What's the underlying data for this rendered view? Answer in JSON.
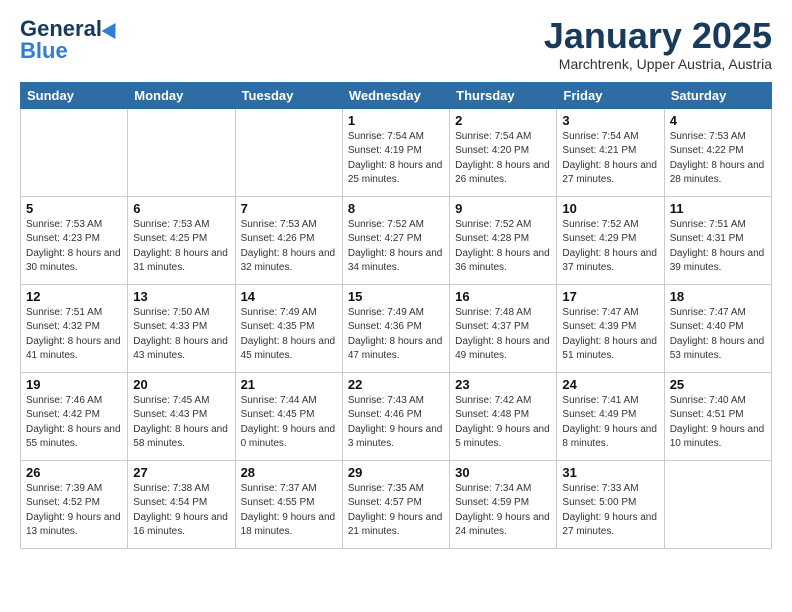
{
  "header": {
    "logo_general": "General",
    "logo_blue": "Blue",
    "month_title": "January 2025",
    "subtitle": "Marchtrenk, Upper Austria, Austria"
  },
  "days_of_week": [
    "Sunday",
    "Monday",
    "Tuesday",
    "Wednesday",
    "Thursday",
    "Friday",
    "Saturday"
  ],
  "weeks": [
    [
      {
        "day": "",
        "info": ""
      },
      {
        "day": "",
        "info": ""
      },
      {
        "day": "",
        "info": ""
      },
      {
        "day": "1",
        "info": "Sunrise: 7:54 AM\nSunset: 4:19 PM\nDaylight: 8 hours and 25 minutes."
      },
      {
        "day": "2",
        "info": "Sunrise: 7:54 AM\nSunset: 4:20 PM\nDaylight: 8 hours and 26 minutes."
      },
      {
        "day": "3",
        "info": "Sunrise: 7:54 AM\nSunset: 4:21 PM\nDaylight: 8 hours and 27 minutes."
      },
      {
        "day": "4",
        "info": "Sunrise: 7:53 AM\nSunset: 4:22 PM\nDaylight: 8 hours and 28 minutes."
      }
    ],
    [
      {
        "day": "5",
        "info": "Sunrise: 7:53 AM\nSunset: 4:23 PM\nDaylight: 8 hours and 30 minutes."
      },
      {
        "day": "6",
        "info": "Sunrise: 7:53 AM\nSunset: 4:25 PM\nDaylight: 8 hours and 31 minutes."
      },
      {
        "day": "7",
        "info": "Sunrise: 7:53 AM\nSunset: 4:26 PM\nDaylight: 8 hours and 32 minutes."
      },
      {
        "day": "8",
        "info": "Sunrise: 7:52 AM\nSunset: 4:27 PM\nDaylight: 8 hours and 34 minutes."
      },
      {
        "day": "9",
        "info": "Sunrise: 7:52 AM\nSunset: 4:28 PM\nDaylight: 8 hours and 36 minutes."
      },
      {
        "day": "10",
        "info": "Sunrise: 7:52 AM\nSunset: 4:29 PM\nDaylight: 8 hours and 37 minutes."
      },
      {
        "day": "11",
        "info": "Sunrise: 7:51 AM\nSunset: 4:31 PM\nDaylight: 8 hours and 39 minutes."
      }
    ],
    [
      {
        "day": "12",
        "info": "Sunrise: 7:51 AM\nSunset: 4:32 PM\nDaylight: 8 hours and 41 minutes."
      },
      {
        "day": "13",
        "info": "Sunrise: 7:50 AM\nSunset: 4:33 PM\nDaylight: 8 hours and 43 minutes."
      },
      {
        "day": "14",
        "info": "Sunrise: 7:49 AM\nSunset: 4:35 PM\nDaylight: 8 hours and 45 minutes."
      },
      {
        "day": "15",
        "info": "Sunrise: 7:49 AM\nSunset: 4:36 PM\nDaylight: 8 hours and 47 minutes."
      },
      {
        "day": "16",
        "info": "Sunrise: 7:48 AM\nSunset: 4:37 PM\nDaylight: 8 hours and 49 minutes."
      },
      {
        "day": "17",
        "info": "Sunrise: 7:47 AM\nSunset: 4:39 PM\nDaylight: 8 hours and 51 minutes."
      },
      {
        "day": "18",
        "info": "Sunrise: 7:47 AM\nSunset: 4:40 PM\nDaylight: 8 hours and 53 minutes."
      }
    ],
    [
      {
        "day": "19",
        "info": "Sunrise: 7:46 AM\nSunset: 4:42 PM\nDaylight: 8 hours and 55 minutes."
      },
      {
        "day": "20",
        "info": "Sunrise: 7:45 AM\nSunset: 4:43 PM\nDaylight: 8 hours and 58 minutes."
      },
      {
        "day": "21",
        "info": "Sunrise: 7:44 AM\nSunset: 4:45 PM\nDaylight: 9 hours and 0 minutes."
      },
      {
        "day": "22",
        "info": "Sunrise: 7:43 AM\nSunset: 4:46 PM\nDaylight: 9 hours and 3 minutes."
      },
      {
        "day": "23",
        "info": "Sunrise: 7:42 AM\nSunset: 4:48 PM\nDaylight: 9 hours and 5 minutes."
      },
      {
        "day": "24",
        "info": "Sunrise: 7:41 AM\nSunset: 4:49 PM\nDaylight: 9 hours and 8 minutes."
      },
      {
        "day": "25",
        "info": "Sunrise: 7:40 AM\nSunset: 4:51 PM\nDaylight: 9 hours and 10 minutes."
      }
    ],
    [
      {
        "day": "26",
        "info": "Sunrise: 7:39 AM\nSunset: 4:52 PM\nDaylight: 9 hours and 13 minutes."
      },
      {
        "day": "27",
        "info": "Sunrise: 7:38 AM\nSunset: 4:54 PM\nDaylight: 9 hours and 16 minutes."
      },
      {
        "day": "28",
        "info": "Sunrise: 7:37 AM\nSunset: 4:55 PM\nDaylight: 9 hours and 18 minutes."
      },
      {
        "day": "29",
        "info": "Sunrise: 7:35 AM\nSunset: 4:57 PM\nDaylight: 9 hours and 21 minutes."
      },
      {
        "day": "30",
        "info": "Sunrise: 7:34 AM\nSunset: 4:59 PM\nDaylight: 9 hours and 24 minutes."
      },
      {
        "day": "31",
        "info": "Sunrise: 7:33 AM\nSunset: 5:00 PM\nDaylight: 9 hours and 27 minutes."
      },
      {
        "day": "",
        "info": ""
      }
    ]
  ]
}
